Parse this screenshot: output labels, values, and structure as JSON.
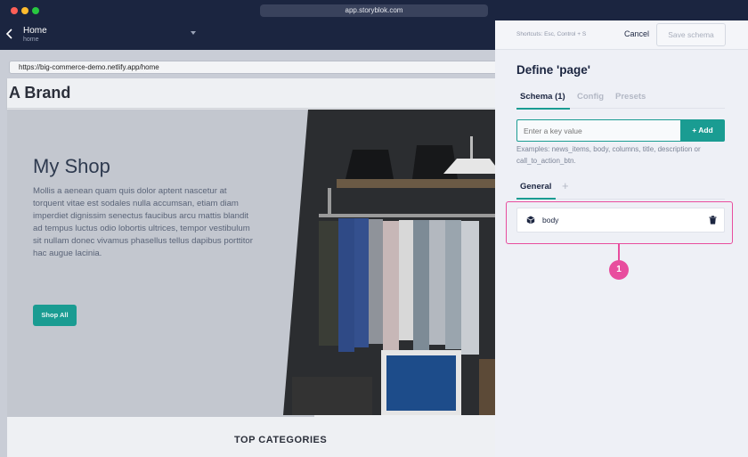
{
  "browser": {
    "url": "app.storyblok.com"
  },
  "header": {
    "title": "Home",
    "slug": "home"
  },
  "preview": {
    "url": "https://big-commerce-demo.netlify.app/home",
    "brand": "A Brand",
    "hero_title": "My Shop",
    "hero_text": "Mollis a aenean quam quis dolor aptent nascetur at torquent vitae est sodales nulla accumsan, etiam diam imperdiet dignissim senectus faucibus arcu mattis blandit ad tempus luctus odio lobortis ultrices, tempor vestibulum sit nullam donec vivamus phasellus tellus dapibus porttitor hac augue lacinia.",
    "shop_button": "Shop All",
    "section_title": "TOP CATEGORIES"
  },
  "panel": {
    "shortcuts": "Shortcuts: Esc, Control + S",
    "cancel_label": "Cancel",
    "save_label": "Save schema",
    "title": "Define 'page'",
    "tabs": [
      {
        "label": "Schema (1)"
      },
      {
        "label": "Config"
      },
      {
        "label": "Presets"
      }
    ],
    "key_placeholder": "Enter a key value",
    "add_label": "+ Add",
    "examples": "Examples: news_items, body, columns, title, description or call_to_action_btn.",
    "group_label": "General",
    "group_add": "+",
    "fields": [
      {
        "name": "body"
      }
    ],
    "annotation_number": "1"
  },
  "colors": {
    "accent": "#1a9c92",
    "highlight": "#e84d9e",
    "chrome": "#1b2540"
  }
}
